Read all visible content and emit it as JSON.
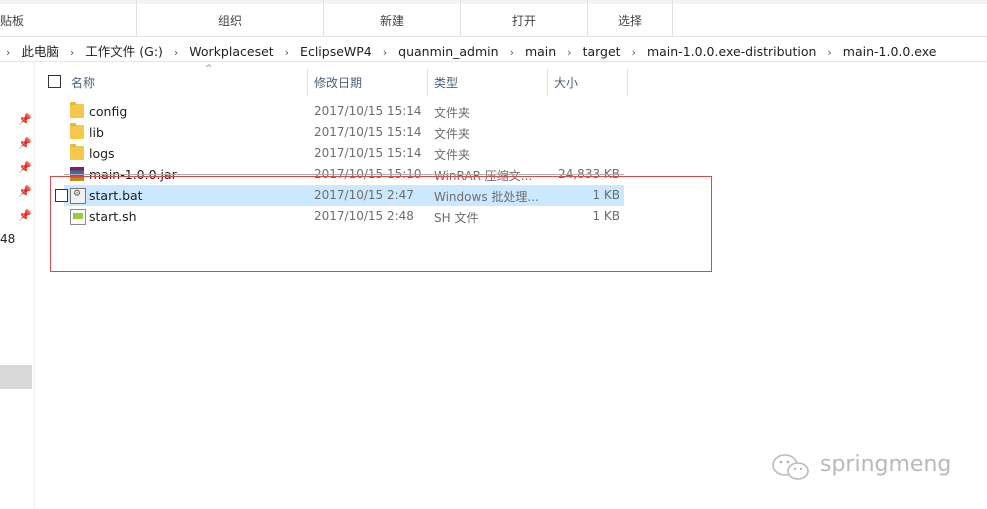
{
  "ribbon": {
    "groups": [
      {
        "label": "贴板"
      },
      {
        "label": "组织"
      },
      {
        "label": "新建"
      },
      {
        "label": "打开"
      },
      {
        "label": "选择"
      }
    ]
  },
  "address": {
    "crumbs": [
      "此电脑",
      "工作文件 (G:)",
      "Workplaceset",
      "EclipseWP4",
      "quanmin_admin",
      "main",
      "target",
      "main-1.0.0.exe-distribution",
      "main-1.0.0.exe"
    ]
  },
  "nav": {
    "fragment": "48"
  },
  "columns": {
    "name": "名称",
    "date": "修改日期",
    "type": "类型",
    "size": "大小"
  },
  "files": [
    {
      "name": "config",
      "date": "2017/10/15 15:14",
      "type": "文件夹",
      "size": "",
      "icon": "folder-icon"
    },
    {
      "name": "lib",
      "date": "2017/10/15 15:14",
      "type": "文件夹",
      "size": "",
      "icon": "folder-icon"
    },
    {
      "name": "logs",
      "date": "2017/10/15 15:14",
      "type": "文件夹",
      "size": "",
      "icon": "folder-icon"
    },
    {
      "name": "main-1.0.0.jar",
      "date": "2017/10/15 15:10",
      "type": "WinRAR 压缩文...",
      "size": "24,833 KB",
      "icon": "winrar-icon"
    },
    {
      "name": "start.bat",
      "date": "2017/10/15 2:47",
      "type": "Windows 批处理...",
      "size": "1 KB",
      "icon": "batch-file-icon"
    },
    {
      "name": "start.sh",
      "date": "2017/10/15 2:48",
      "type": "SH 文件",
      "size": "1 KB",
      "icon": "sh-file-icon"
    }
  ],
  "watermark": "springmeng",
  "colors": {
    "highlight": "#cce8ff",
    "annotation": "#d84a4a",
    "folder": "#f4c84a"
  }
}
